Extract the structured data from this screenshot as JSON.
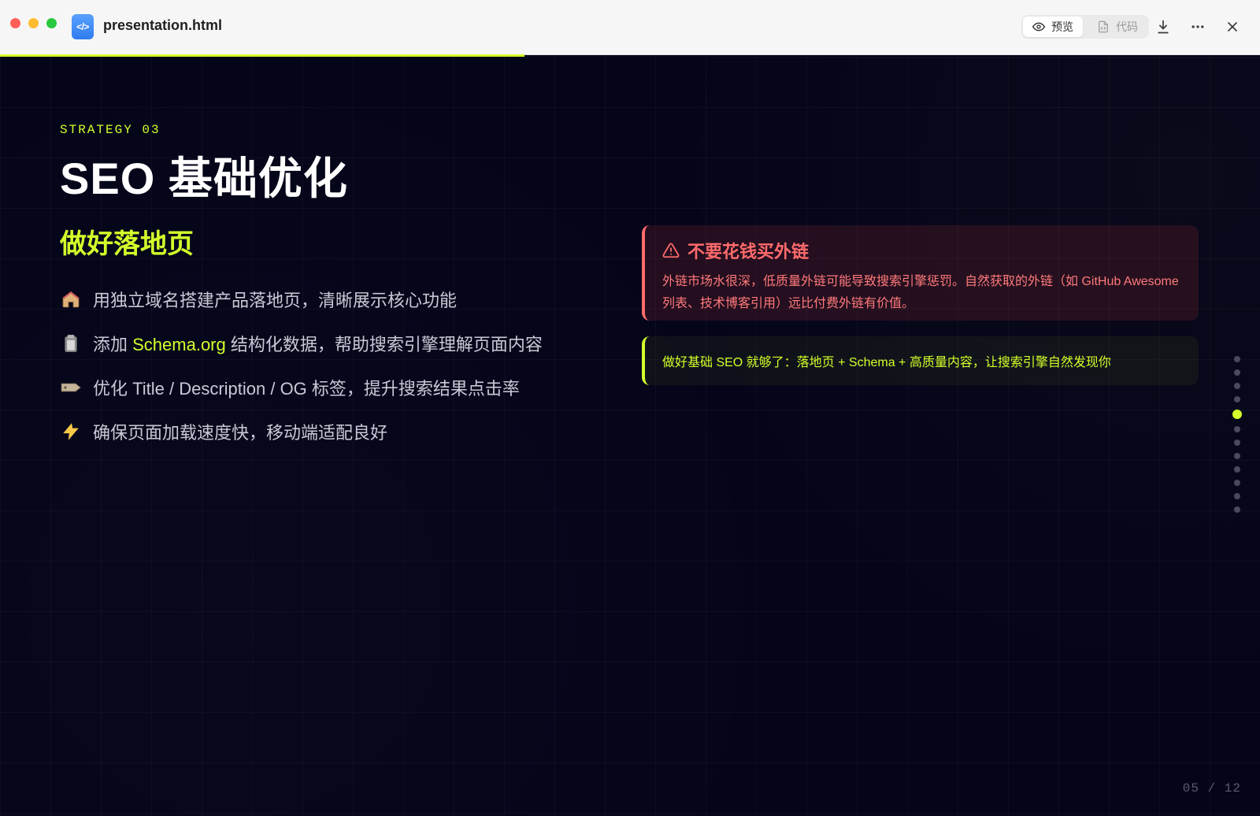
{
  "window": {
    "file_name": "presentation.html",
    "segmented": {
      "preview_label": "预览",
      "code_label": "代码"
    },
    "actions": {
      "download_icon": "download-icon",
      "more_icon": "more-icon",
      "close_icon": "close-icon"
    },
    "progress_fraction": 0.416
  },
  "slide": {
    "eyebrow": "STRATEGY 03",
    "title": "SEO 基础优化",
    "section_title": "做好落地页",
    "bullets": [
      {
        "icon": "house-icon",
        "text": "用独立域名搭建产品落地页，清晰展示核心功能"
      },
      {
        "icon": "clipboard-icon",
        "prefix": "添加 ",
        "highlight": "Schema.org",
        "suffix": " 结构化数据，帮助搜索引擎理解页面内容"
      },
      {
        "icon": "tag-icon",
        "text": "优化 Title / Description / OG 标签，提升搜索结果点击率"
      },
      {
        "icon": "lightning-icon",
        "text": "确保页面加载速度快，移动端适配良好"
      }
    ],
    "warning": {
      "icon": "warning-triangle-icon",
      "title": "不要花钱买外链",
      "text": "外链市场水很深，低质量外链可能导致搜索引擎惩罚。自然获取的外链（如 GitHub Awesome 列表、技术博客引用）远比付费外链有价值。"
    },
    "tip": {
      "text": "做好基础 SEO 就够了：落地页 + Schema + 高质量内容，让搜索引擎自然发现你"
    },
    "pager": {
      "current": "05",
      "total": "12",
      "separator": "/",
      "active_index": 4,
      "dots_count": 12
    }
  },
  "colors": {
    "accent": "#D4FF2A",
    "danger": "#FF6B6B",
    "background": "#05051A"
  }
}
